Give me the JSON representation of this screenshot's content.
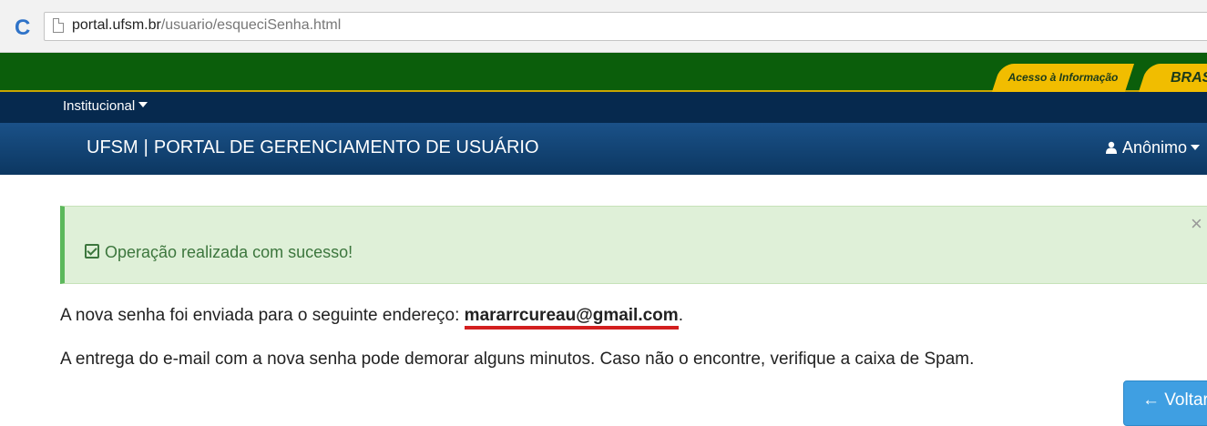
{
  "browser": {
    "reload_glyph": "C",
    "url_host": "portal.ufsm.br",
    "url_path": "/usuario/esqueciSenha.html"
  },
  "gov_bar": {
    "acesso_label": "Acesso à Informação",
    "brasil_label": "BRASIL"
  },
  "institutional_menu": {
    "label": "Institucional"
  },
  "header": {
    "brand": "UFSM",
    "separator": "|",
    "title": "PORTAL DE GERENCIAMENTO DE USUÁRIO",
    "user_label": "Anônimo"
  },
  "alert": {
    "message": "Operação realizada com sucesso!",
    "close_glyph": "×"
  },
  "content": {
    "sent_prefix": "A nova senha foi enviada para o seguinte endereço:",
    "email": "mararrcureau@gmail.com",
    "sent_suffix": ".",
    "delivery_note": "A entrega do e-mail com a nova senha pode demorar alguns minutos. Caso não o encontre, verifique a caixa de Spam."
  },
  "actions": {
    "back_arrow": "←",
    "back_label": "Voltar"
  },
  "colors": {
    "gov_green": "#0b5e0b",
    "gov_yellow": "#f1bd00",
    "nav_navy": "#06294e",
    "header_blue": "#1a5188",
    "alert_bg": "#dff0d8",
    "alert_text": "#3c763d",
    "button_blue": "#3f9fe2",
    "email_underline": "#d31f1f"
  }
}
